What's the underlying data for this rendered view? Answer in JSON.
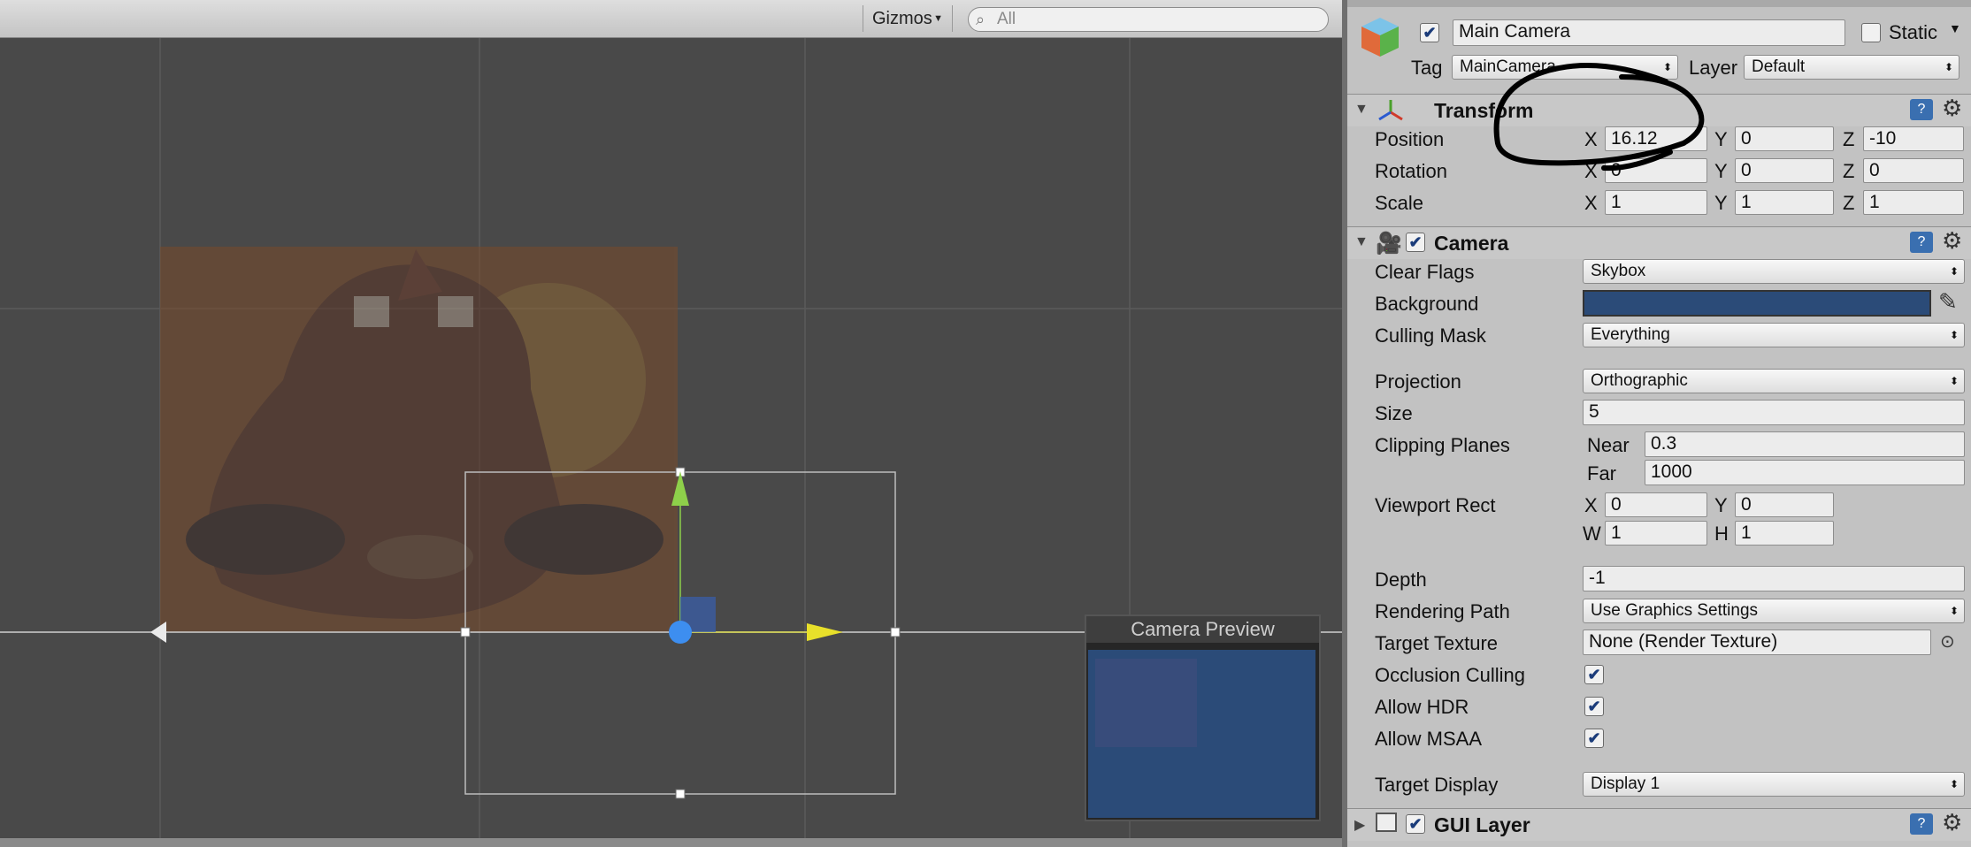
{
  "scene": {
    "gizmos_label": "Gizmos",
    "search_placeholder": "All",
    "camera_preview_title": "Camera Preview"
  },
  "inspector": {
    "object": {
      "active": true,
      "name": "Main Camera",
      "static_label": "Static",
      "static_checked": false,
      "tag_label": "Tag",
      "tag_value": "MainCamera",
      "layer_label": "Layer",
      "layer_value": "Default"
    },
    "transform": {
      "title": "Transform",
      "position_label": "Position",
      "rotation_label": "Rotation",
      "scale_label": "Scale",
      "axis_x": "X",
      "axis_y": "Y",
      "axis_z": "Z",
      "position": {
        "x": "16.12",
        "y": "0",
        "z": "-10"
      },
      "rotation": {
        "x": "0",
        "y": "0",
        "z": "0"
      },
      "scale": {
        "x": "1",
        "y": "1",
        "z": "1"
      }
    },
    "camera": {
      "title": "Camera",
      "clear_flags_label": "Clear Flags",
      "clear_flags_value": "Skybox",
      "background_label": "Background",
      "background_color": "#2b4b78",
      "culling_mask_label": "Culling Mask",
      "culling_mask_value": "Everything",
      "projection_label": "Projection",
      "projection_value": "Orthographic",
      "size_label": "Size",
      "size_value": "5",
      "clipping_label": "Clipping Planes",
      "near_label": "Near",
      "near_value": "0.3",
      "far_label": "Far",
      "far_value": "1000",
      "viewport_label": "Viewport Rect",
      "vx_label": "X",
      "vx": "0",
      "vy_label": "Y",
      "vy": "0",
      "vw_label": "W",
      "vw": "1",
      "vh_label": "H",
      "vh": "1",
      "depth_label": "Depth",
      "depth_value": "-1",
      "rendering_path_label": "Rendering Path",
      "rendering_path_value": "Use Graphics Settings",
      "target_texture_label": "Target Texture",
      "target_texture_value": "None (Render Texture)",
      "occlusion_label": "Occlusion Culling",
      "hdr_label": "Allow HDR",
      "msaa_label": "Allow MSAA",
      "target_display_label": "Target Display",
      "target_display_value": "Display 1"
    },
    "gui_layer": {
      "title": "GUI Layer"
    }
  }
}
